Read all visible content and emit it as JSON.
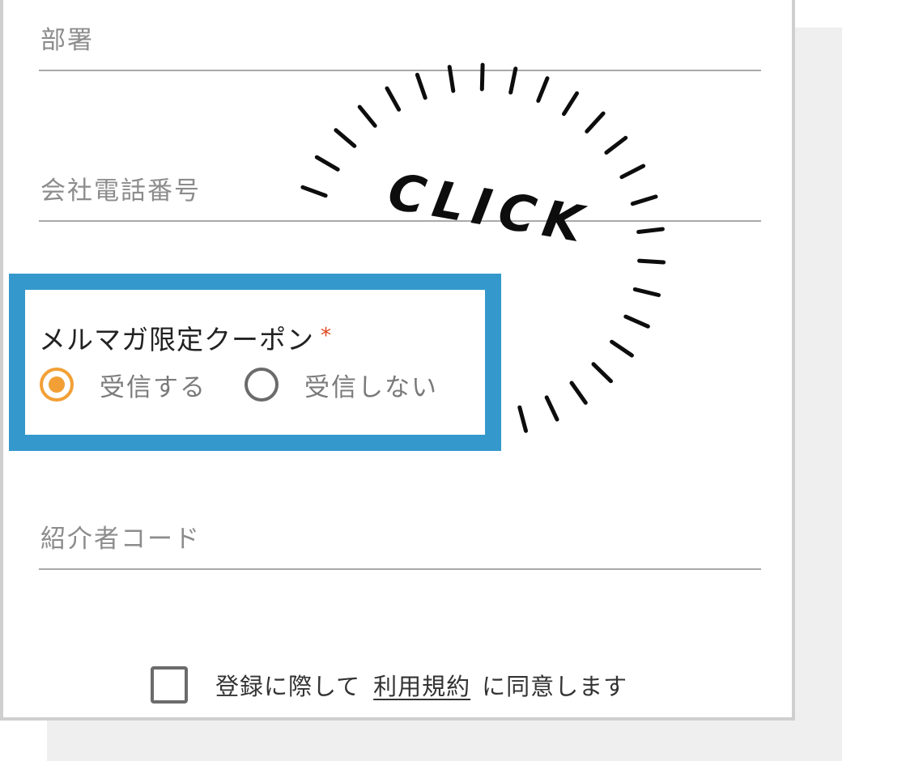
{
  "form": {
    "fields": {
      "department": {
        "placeholder": "部署",
        "value": ""
      },
      "company_phone": {
        "placeholder": "会社電話番号",
        "value": ""
      },
      "referral_code": {
        "placeholder": "紹介者コード",
        "value": ""
      }
    },
    "newsletter_coupon": {
      "label": "メルマガ限定クーポン",
      "required_mark": "*",
      "options": [
        {
          "label": "受信する",
          "selected": true
        },
        {
          "label": "受信しない",
          "selected": false
        }
      ]
    },
    "consent": {
      "checked": false,
      "text_before": "登録に際して",
      "terms_link": "利用規約",
      "text_after": "に同意します"
    }
  },
  "annotation": {
    "text": "CLICK",
    "icon": "click-burst-icon"
  },
  "colors": {
    "highlight_border": "#3498cc",
    "radio_selected": "#f2a036",
    "required": "#e0461d",
    "field_line": "#a9a9a9",
    "shadow": "#efefef"
  }
}
